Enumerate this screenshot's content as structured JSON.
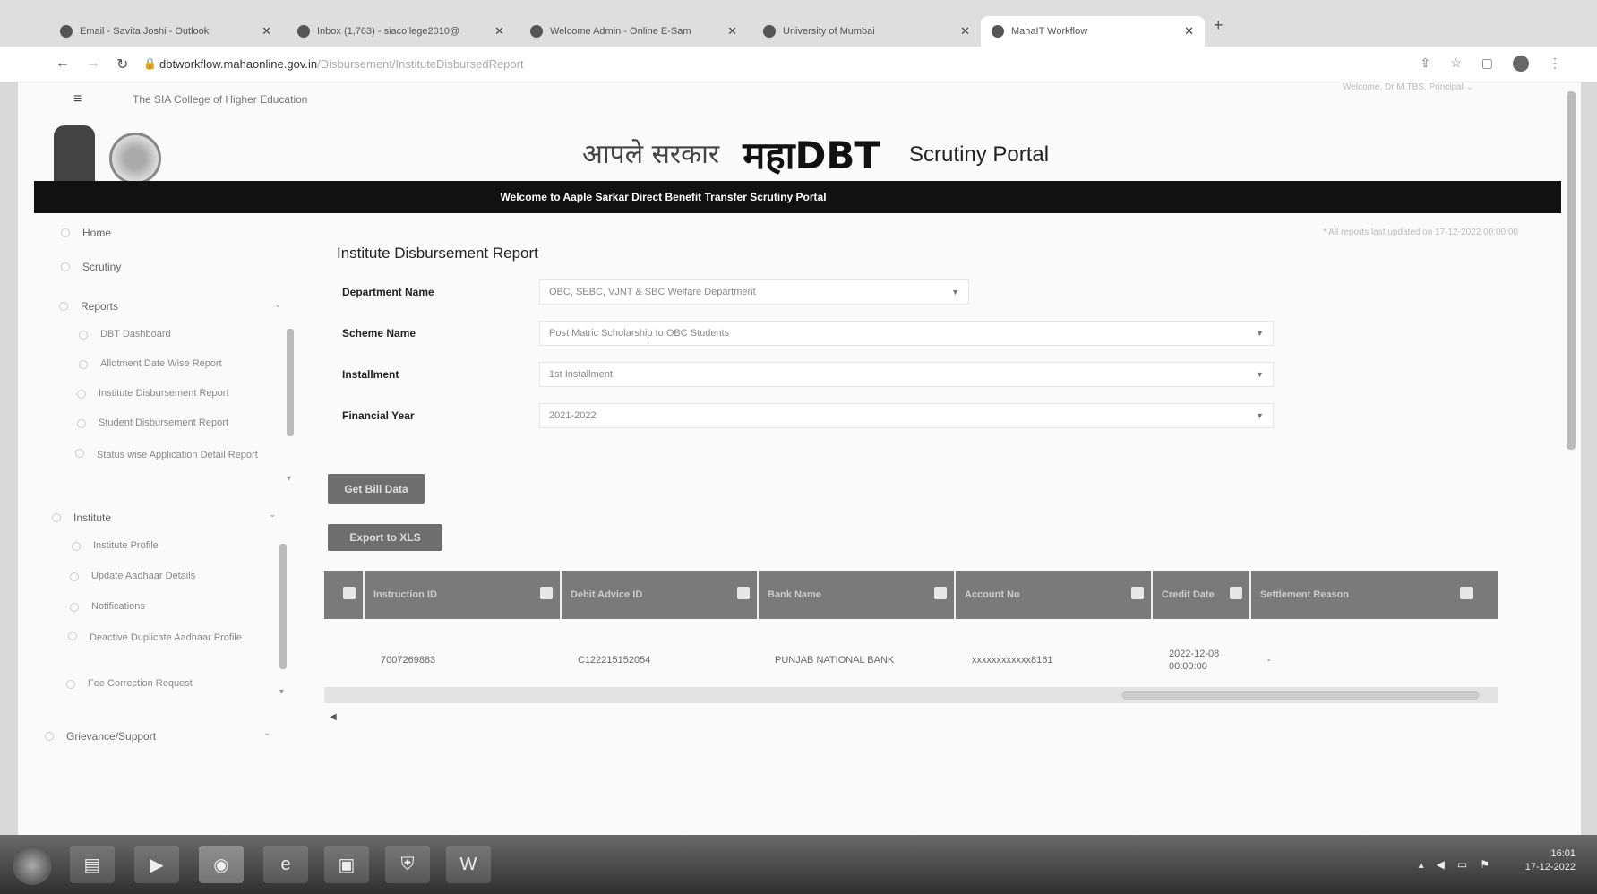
{
  "browser": {
    "tabs": [
      {
        "label": "Email - Savita Joshi - Outlook",
        "active": false
      },
      {
        "label": "Inbox (1,763) - siacollege2010@",
        "active": false
      },
      {
        "label": "Welcome Admin - Online E-Sam",
        "active": false
      },
      {
        "label": "University of Mumbai",
        "active": false
      },
      {
        "label": "MahaIT Workflow",
        "active": true
      }
    ],
    "url_host": "dbtworkflow.mahaonline.gov.in",
    "url_path": "/Disbursement/InstituteDisbursedReport"
  },
  "header": {
    "college_name": "The SIA College of Higher Education",
    "welcome_user": "Welcome, Dr M.TBS, Principal",
    "brand_aaple": "आपले सरकार",
    "brand_maha": "महाDBT",
    "portal_title": "Scrutiny Portal",
    "banner": "Welcome to Aaple Sarkar Direct Benefit Transfer Scrutiny Portal",
    "last_updated": "* All reports last updated on 17-12-2022 00:00:00"
  },
  "sidebar": {
    "home": "Home",
    "scrutiny": "Scrutiny",
    "reports": "Reports",
    "report_items": [
      "DBT Dashboard",
      "Allotment Date Wise Report",
      "Institute Disbursement Report",
      "Student Disbursement Report",
      "Status wise Application Detail Report"
    ],
    "institute": "Institute",
    "institute_items": [
      "Institute Profile",
      "Update Aadhaar Details",
      "Notifications",
      "Deactive Duplicate Aadhaar Profile",
      "Fee Correction Request"
    ],
    "grievance": "Grievance/Support"
  },
  "form": {
    "title": "Institute Disbursement Report",
    "department_label": "Department Name",
    "department_value": "OBC, SEBC, VJNT & SBC Welfare Department",
    "scheme_label": "Scheme Name",
    "scheme_value": "Post Matric Scholarship to OBC Students",
    "installment_label": "Installment",
    "installment_value": "1st Installment",
    "year_label": "Financial Year",
    "year_value": "2021-2022",
    "get_button": "Get Bill Data",
    "export_button": "Export to XLS"
  },
  "table": {
    "headers": [
      "Instruction ID",
      "Debit Advice ID",
      "Bank Name",
      "Account No",
      "Credit Date",
      "Settlement Reason"
    ],
    "rows": [
      [
        "7007269883",
        "C122215152054",
        "PUNJAB NATIONAL BANK",
        "xxxxxxxxxxxx8161",
        "2022-12-08 00:00:00",
        "-"
      ]
    ]
  },
  "taskbar": {
    "time": "16:01",
    "date": "17-12-2022"
  }
}
